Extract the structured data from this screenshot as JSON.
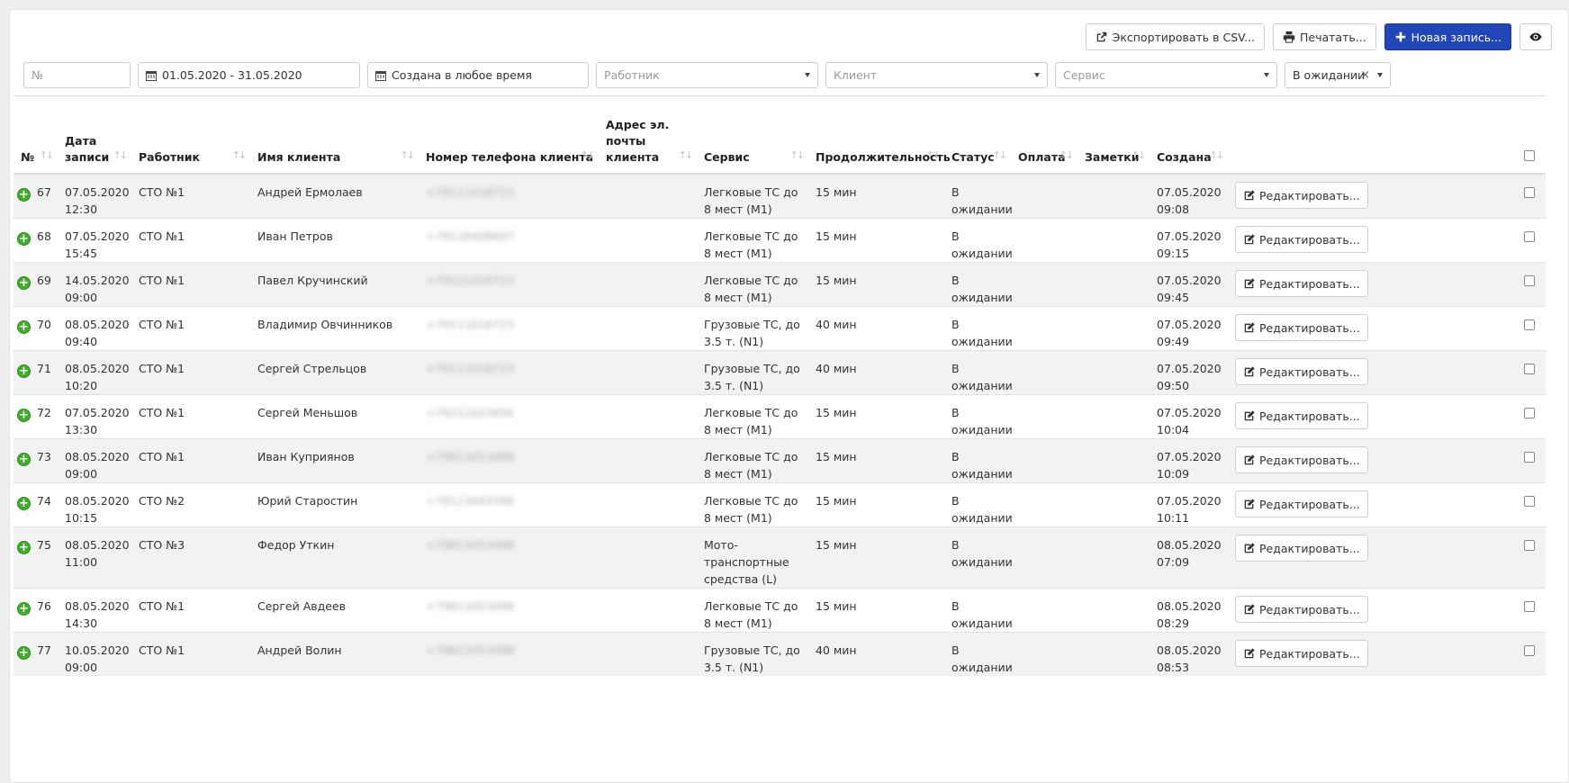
{
  "toolbar": {
    "export_label": "Экспортировать в CSV...",
    "print_label": "Печатать...",
    "new_label": "Новая запись..."
  },
  "filters": {
    "number_placeholder": "№",
    "date_range": "01.05.2020 - 31.05.2020",
    "created": "Создана в любое время",
    "worker_placeholder": "Работник",
    "client_placeholder": "Клиент",
    "service_placeholder": "Сервис",
    "status": "В ожидании",
    "clear": "×"
  },
  "columns": {
    "num": "№",
    "date": "Дата записи",
    "worker": "Работник",
    "client": "Имя клиента",
    "phone": "Номер телефона клиента",
    "email": "Адрес эл. почты клиента",
    "service": "Сервис",
    "duration": "Продолжительность",
    "status": "Статус",
    "payment": "Оплата",
    "notes": "Заметки",
    "created": "Создана"
  },
  "edit_label": "Редактировать...",
  "rows": [
    {
      "num": "67",
      "date": "07.05.2020 12:30",
      "worker": "СТО №1",
      "client": "Андрей Ермолаев",
      "phone": "+79111018723",
      "service": "Легковые ТС до 8 мест (M1)",
      "duration": "15 мин",
      "status": "В ожидании",
      "created": "07.05.2020 09:08"
    },
    {
      "num": "68",
      "date": "07.05.2020 15:45",
      "worker": "СТО №1",
      "client": "Иван Петров",
      "phone": "+79126409697",
      "service": "Легковые ТС до 8 мест (M1)",
      "duration": "15 мин",
      "status": "В ожидании",
      "created": "07.05.2020 09:15"
    },
    {
      "num": "69",
      "date": "14.05.2020 09:00",
      "worker": "СТО №1",
      "client": "Павел Кручинский",
      "phone": "+79121028723",
      "service": "Легковые ТС до 8 мест (M1)",
      "duration": "15 мин",
      "status": "В ожидании",
      "created": "07.05.2020 09:45"
    },
    {
      "num": "70",
      "date": "08.05.2020 09:40",
      "worker": "СТО №1",
      "client": "Владимир Овчинников",
      "phone": "+79111018723",
      "service": "Грузовые ТС, до 3.5 т. (N1)",
      "duration": "40 мин",
      "status": "В ожидании",
      "created": "07.05.2020 09:49"
    },
    {
      "num": "71",
      "date": "08.05.2020 10:20",
      "worker": "СТО №1",
      "client": "Сергей Стрельцов",
      "phone": "+79111018723",
      "service": "Грузовые ТС, до 3.5 т. (N1)",
      "duration": "40 мин",
      "status": "В ожидании",
      "created": "07.05.2020 09:50"
    },
    {
      "num": "72",
      "date": "07.05.2020 13:30",
      "worker": "СТО №1",
      "client": "Сергей Меньшов",
      "phone": "+79211023456",
      "service": "Легковые ТС до 8 мест (M1)",
      "duration": "15 мин",
      "status": "В ожидании",
      "created": "07.05.2020 10:04"
    },
    {
      "num": "73",
      "date": "08.05.2020 09:00",
      "worker": "СТО №1",
      "client": "Иван Куприянов",
      "phone": "+79813453498",
      "service": "Легковые ТС до 8 мест (M1)",
      "duration": "15 мин",
      "status": "В ожидании",
      "created": "07.05.2020 10:09"
    },
    {
      "num": "74",
      "date": "08.05.2020 10:15",
      "worker": "СТО №2",
      "client": "Юрий Старостин",
      "phone": "+79113443398",
      "service": "Легковые ТС до 8 мест (M1)",
      "duration": "15 мин",
      "status": "В ожидании",
      "created": "07.05.2020 10:11"
    },
    {
      "num": "75",
      "date": "08.05.2020 11:00",
      "worker": "СТО №3",
      "client": "Федор Уткин",
      "phone": "+79813453498",
      "service": "Мото-транспортные средства (L)",
      "duration": "15 мин",
      "status": "В ожидании",
      "created": "08.05.2020 07:09"
    },
    {
      "num": "76",
      "date": "08.05.2020 14:30",
      "worker": "СТО №1",
      "client": "Сергей Авдеев",
      "phone": "+79813453498",
      "service": "Легковые ТС до 8 мест (M1)",
      "duration": "15 мин",
      "status": "В ожидании",
      "created": "08.05.2020 08:29"
    },
    {
      "num": "77",
      "date": "10.05.2020 09:00",
      "worker": "СТО №1",
      "client": "Андрей Волин",
      "phone": "+79813453498",
      "service": "Грузовые ТС, до 3.5 т. (N1)",
      "duration": "40 мин",
      "status": "В ожидании",
      "created": "08.05.2020 08:53"
    }
  ]
}
